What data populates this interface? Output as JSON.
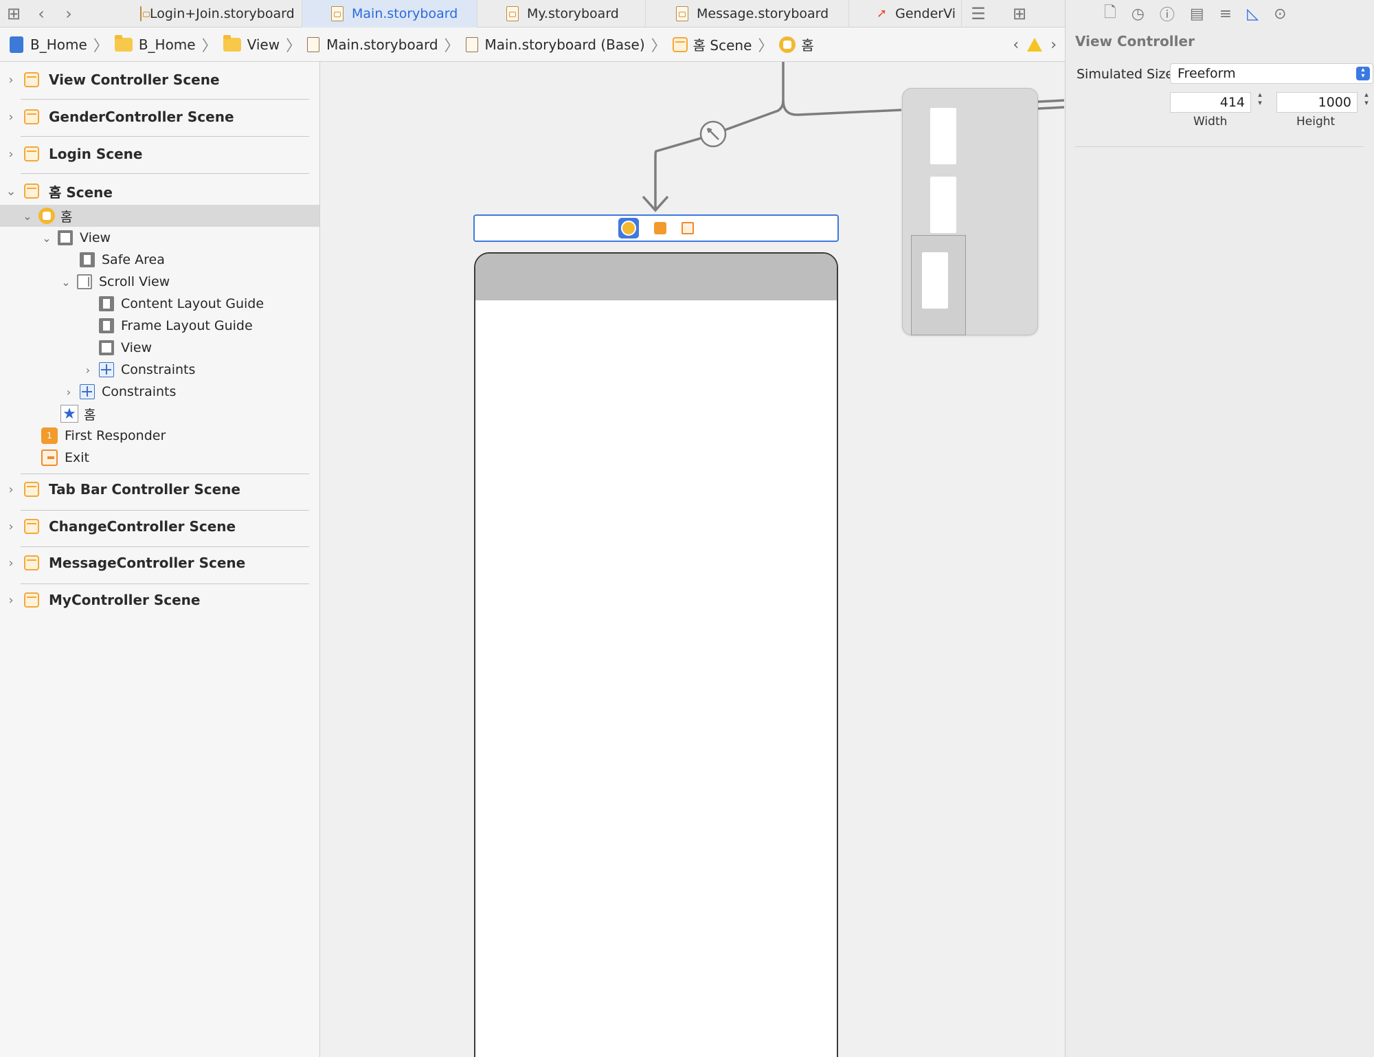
{
  "tabs": [
    {
      "label": "Login+Join.storyboard",
      "active": false,
      "kind": "storyboard"
    },
    {
      "label": "Main.storyboard",
      "active": true,
      "kind": "storyboard"
    },
    {
      "label": "My.storyboard",
      "active": false,
      "kind": "storyboard"
    },
    {
      "label": "Message.storyboard",
      "active": false,
      "kind": "storyboard"
    },
    {
      "label": "GenderVi",
      "active": false,
      "kind": "swift"
    }
  ],
  "breadcrumb": {
    "items": [
      "B_Home",
      "B_Home",
      "View",
      "Main.storyboard",
      "Main.storyboard (Base)",
      "홈 Scene",
      "홈"
    ]
  },
  "navigator": {
    "scenes_top": [
      "View Controller Scene",
      "GenderController Scene",
      "Login Scene",
      "홈 Scene"
    ],
    "tree": {
      "controller": "홈",
      "view": "View",
      "safe_area": "Safe Area",
      "scroll_view": "Scroll View",
      "content_layout_guide": "Content Layout Guide",
      "frame_layout_guide": "Frame Layout Guide",
      "inner_view": "View",
      "inner_constraints": "Constraints",
      "outer_constraints": "Constraints",
      "tab_item": "홈",
      "first_responder": "First Responder",
      "exit": "Exit"
    },
    "scenes_bottom": [
      "Tab Bar Controller Scene",
      "ChangeController Scene",
      "MessageController Scene",
      "MyController Scene"
    ]
  },
  "inspector": {
    "title": "View Controller",
    "simulated_size_label": "Simulated Size",
    "simulated_size_value": "Freeform",
    "width_value": "414",
    "height_value": "1000",
    "width_label": "Width",
    "height_label": "Height"
  },
  "colors": {
    "accent": "#2a6ae0",
    "scene_icon": "#f2a83b",
    "warning": "#f5c423"
  }
}
